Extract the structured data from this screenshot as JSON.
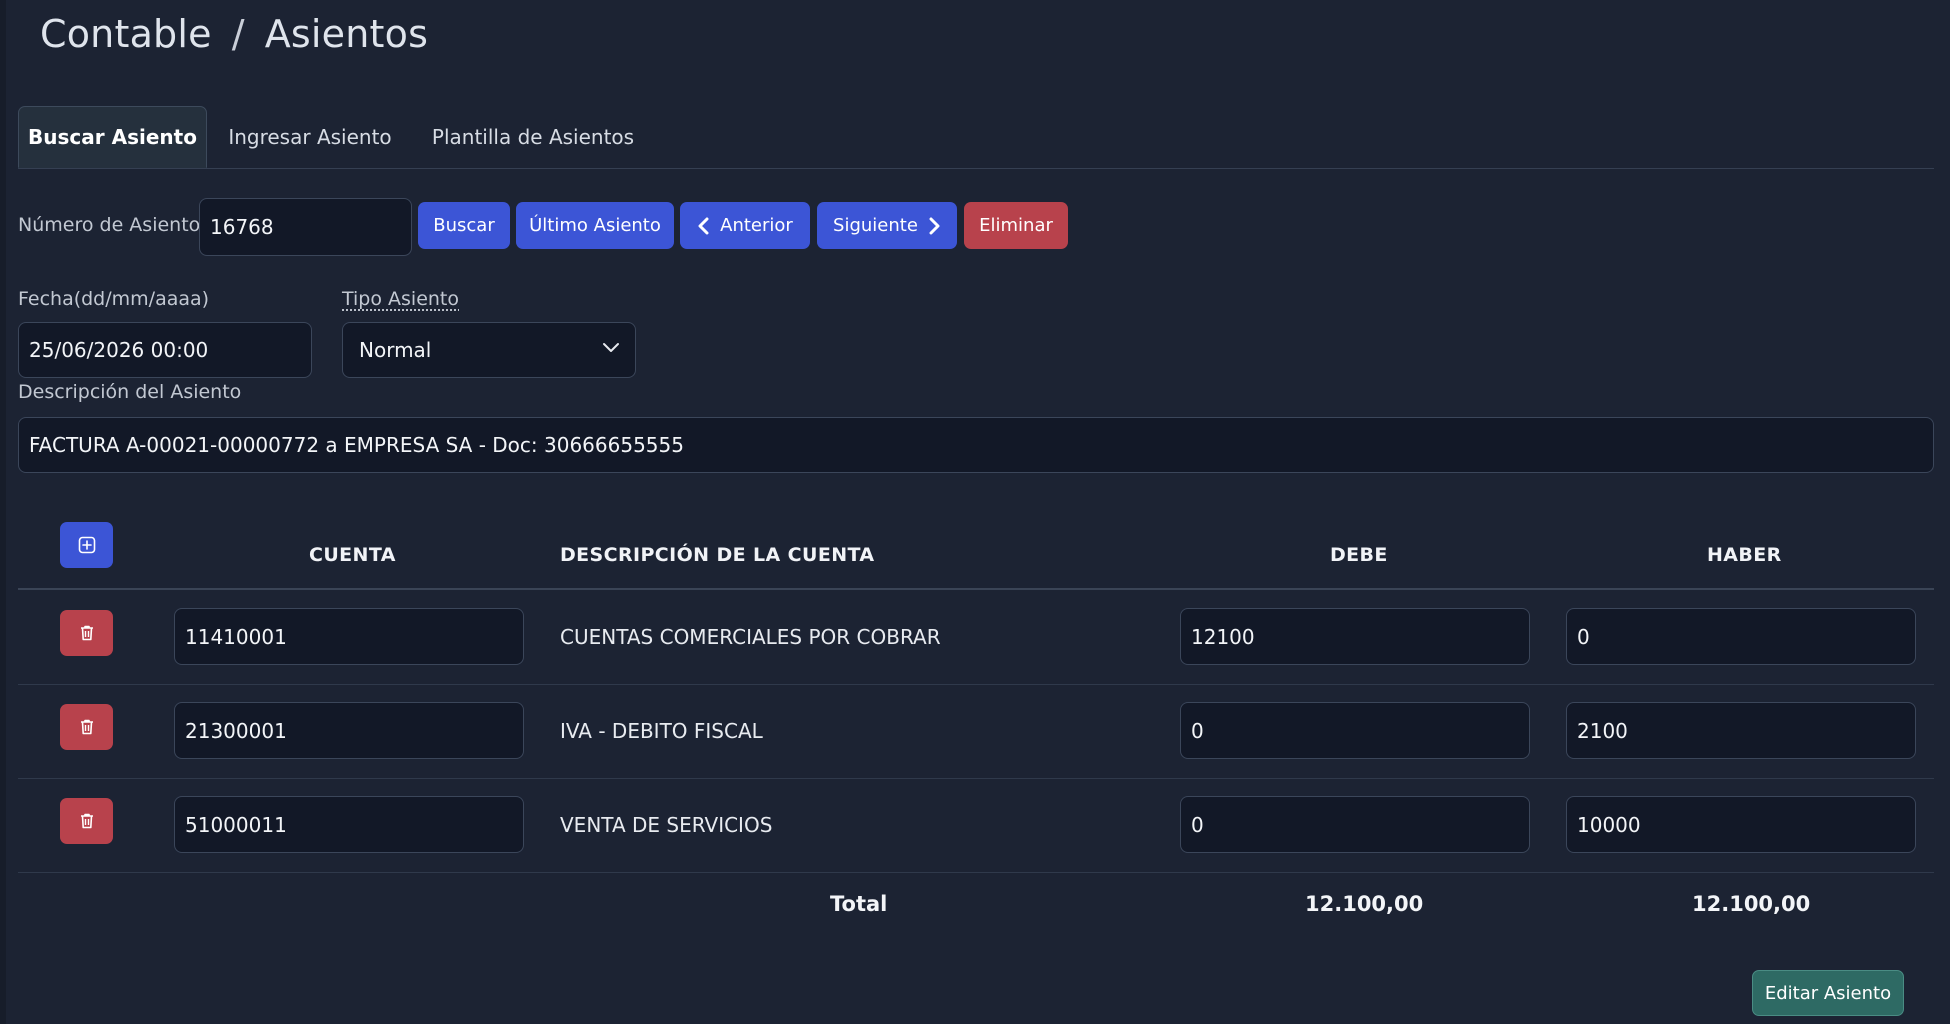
{
  "breadcrumb": {
    "section": "Contable",
    "separator": "/",
    "page": "Asientos"
  },
  "tabs": [
    {
      "label": "Buscar Asiento",
      "active": true
    },
    {
      "label": "Ingresar Asiento",
      "active": false
    },
    {
      "label": "Plantilla de Asientos",
      "active": false
    }
  ],
  "search": {
    "label": "Número de Asiento",
    "value": "16768",
    "buttons": {
      "buscar": "Buscar",
      "ultimo": "Último Asiento",
      "anterior": "Anterior",
      "siguiente": "Siguiente",
      "eliminar": "Eliminar"
    }
  },
  "form": {
    "fecha_label": "Fecha(dd/mm/aaaa)",
    "fecha_value": "25/06/2026 00:00",
    "tipo_label": "Tipo Asiento",
    "tipo_value": "Normal",
    "descripcion_label": "Descripción del Asiento",
    "descripcion_value": "FACTURA A-00021-00000772 a EMPRESA SA - Doc: 30666655555"
  },
  "table": {
    "headers": {
      "cuenta": "CUENTA",
      "descripcion": "DESCRIPCIÓN DE LA CUENTA",
      "debe": "DEBE",
      "haber": "HABER"
    },
    "rows": [
      {
        "cuenta": "11410001",
        "descripcion": "CUENTAS COMERCIALES POR COBRAR",
        "debe": "12100",
        "haber": "0"
      },
      {
        "cuenta": "21300001",
        "descripcion": "IVA - DEBITO FISCAL",
        "debe": "0",
        "haber": "2100"
      },
      {
        "cuenta": "51000011",
        "descripcion": "VENTA DE SERVICIOS",
        "debe": "0",
        "haber": "10000"
      }
    ],
    "total_label": "Total",
    "total_debe": "12.100,00",
    "total_haber": "12.100,00"
  },
  "actions": {
    "editar": "Editar Asiento"
  },
  "icons": {
    "add_row": "plus-square-icon",
    "delete_row": "trash-icon",
    "prev": "chevron-left-icon",
    "next": "chevron-right-icon",
    "dropdown": "chevron-down-icon"
  },
  "colors": {
    "background": "#1c2333",
    "primary": "#3c55d6",
    "danger": "#b8424c",
    "success": "#2e6a64"
  }
}
